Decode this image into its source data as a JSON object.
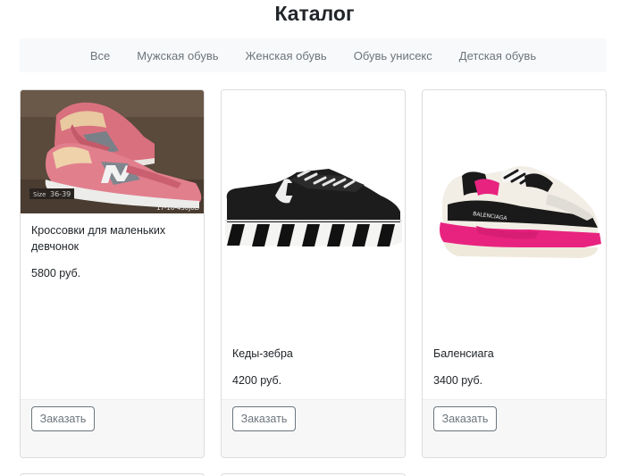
{
  "page": {
    "title": "Каталог"
  },
  "nav": {
    "items": [
      {
        "label": "Все"
      },
      {
        "label": "Мужская обувь"
      },
      {
        "label": "Женская обувь"
      },
      {
        "label": "Обувь унисекс"
      },
      {
        "label": "Детская обувь"
      }
    ]
  },
  "products": [
    {
      "title": "Кроссовки для маленьких девчонок",
      "price": "5800 руб.",
      "button": "Заказать",
      "image_caption": "17-10-450J6D",
      "size_tag": "36-39"
    },
    {
      "title": "Кеды-зебра",
      "price": "4200 руб.",
      "button": "Заказать"
    },
    {
      "title": "Баленсиага",
      "price": "3400 руб.",
      "button": "Заказать",
      "brand_print": "BALENCIAGA"
    }
  ],
  "colors": {
    "nav_bg": "#f8f9fa",
    "nav_text": "#6c757d",
    "border": "#dcdcdc",
    "button_border": "#6c757d",
    "accent_pink": "#e8237f"
  }
}
